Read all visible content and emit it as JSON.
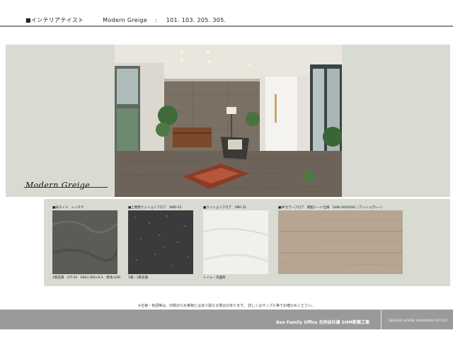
{
  "header": {
    "category": "■インテリアテイスト",
    "theme": "Modern Greige",
    "colon": ":",
    "rooms": "101. 103. 205. 305."
  },
  "main": {
    "title": "Modern Greige"
  },
  "swatches": [
    {
      "label": "■床タイル　レンチナ",
      "caption": "1階玄関　LYT-50　600×300×9.2　目地:GAR",
      "color": "#5b5b57"
    },
    {
      "label": "■土間用クッションフロア　SMD-15",
      "caption": "1階・2階玄関",
      "color": "#3a3b3d"
    },
    {
      "label": "■クッションフロア　SMF-21",
      "caption": "トイレ・洗面所",
      "color": "#f1f0ec"
    },
    {
      "label": "■8Pカラーフロア　樹脂シート仕様　SAW-3042ASG（アッシュグレー）",
      "caption": "",
      "color": "#b5a592"
    }
  ],
  "notice": "※仕様・色調等は、印刷のため実物とは多少異なる場合があります。 詳しくはサンプル等でお確かめください。",
  "footer": {
    "company": "Ken Family Office 合同会社様 SHM新築工事",
    "office": "SEKISUI HOUSE HOKURIKU OFFICE"
  }
}
